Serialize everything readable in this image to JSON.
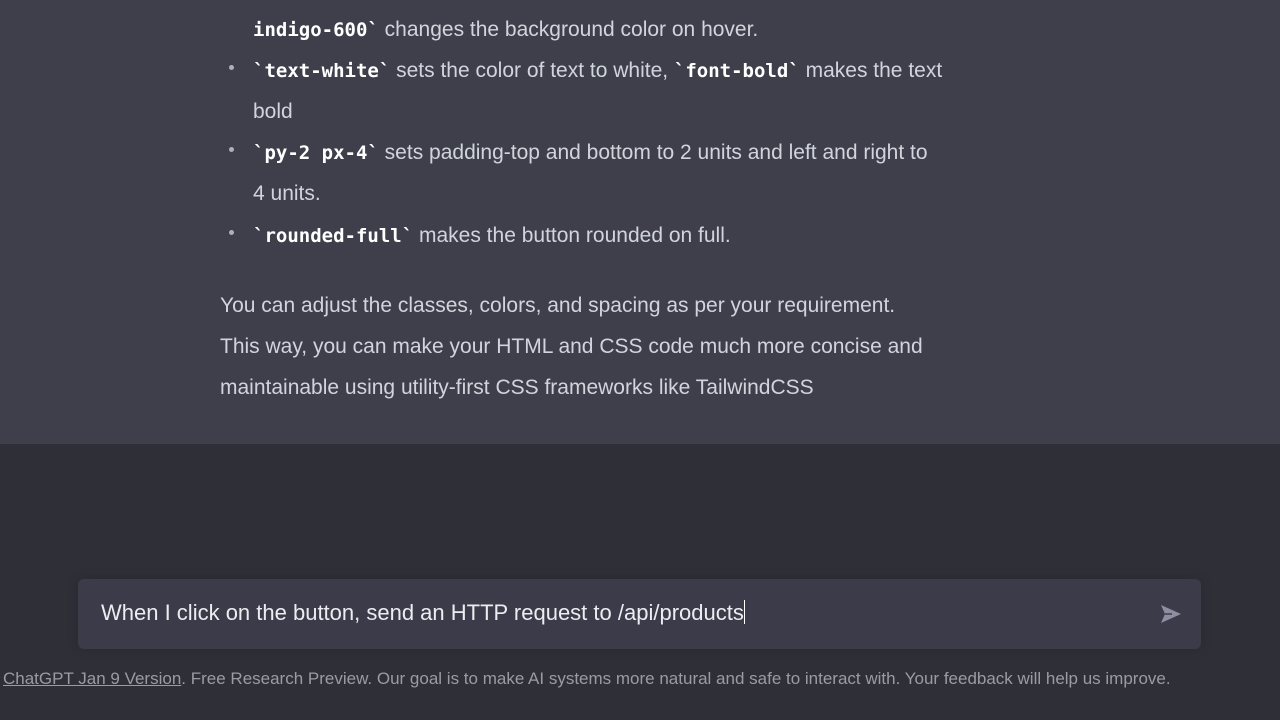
{
  "message": {
    "items": [
      {
        "code": "indigo-600`",
        "text": " changes the background color on hover."
      },
      {
        "code": "`text-white`",
        "text": " sets the color of text to white, ",
        "code2": "`font-bold`",
        "text2": " makes the text",
        "cont": "bold"
      },
      {
        "code": "`py-2 px-4`",
        "text": " sets padding-top and bottom to 2 units and left and right to",
        "cont": "4 units."
      },
      {
        "code": "`rounded-full`",
        "text": " makes the button rounded on full."
      }
    ],
    "paragraph": [
      "You can adjust the classes, colors, and spacing as per your requirement.",
      "This way, you can make your HTML and CSS code much more concise and",
      "maintainable using utility-first CSS frameworks like TailwindCSS"
    ]
  },
  "input": {
    "value": "When I click on the button, send an HTTP request to /api/products",
    "send_icon": "paper-plane-icon"
  },
  "footer": {
    "link": "ChatGPT Jan 9 Version",
    "text": ". Free Research Preview. Our goal is to make AI systems more natural and safe to interact with. Your feedback will help us improve."
  }
}
